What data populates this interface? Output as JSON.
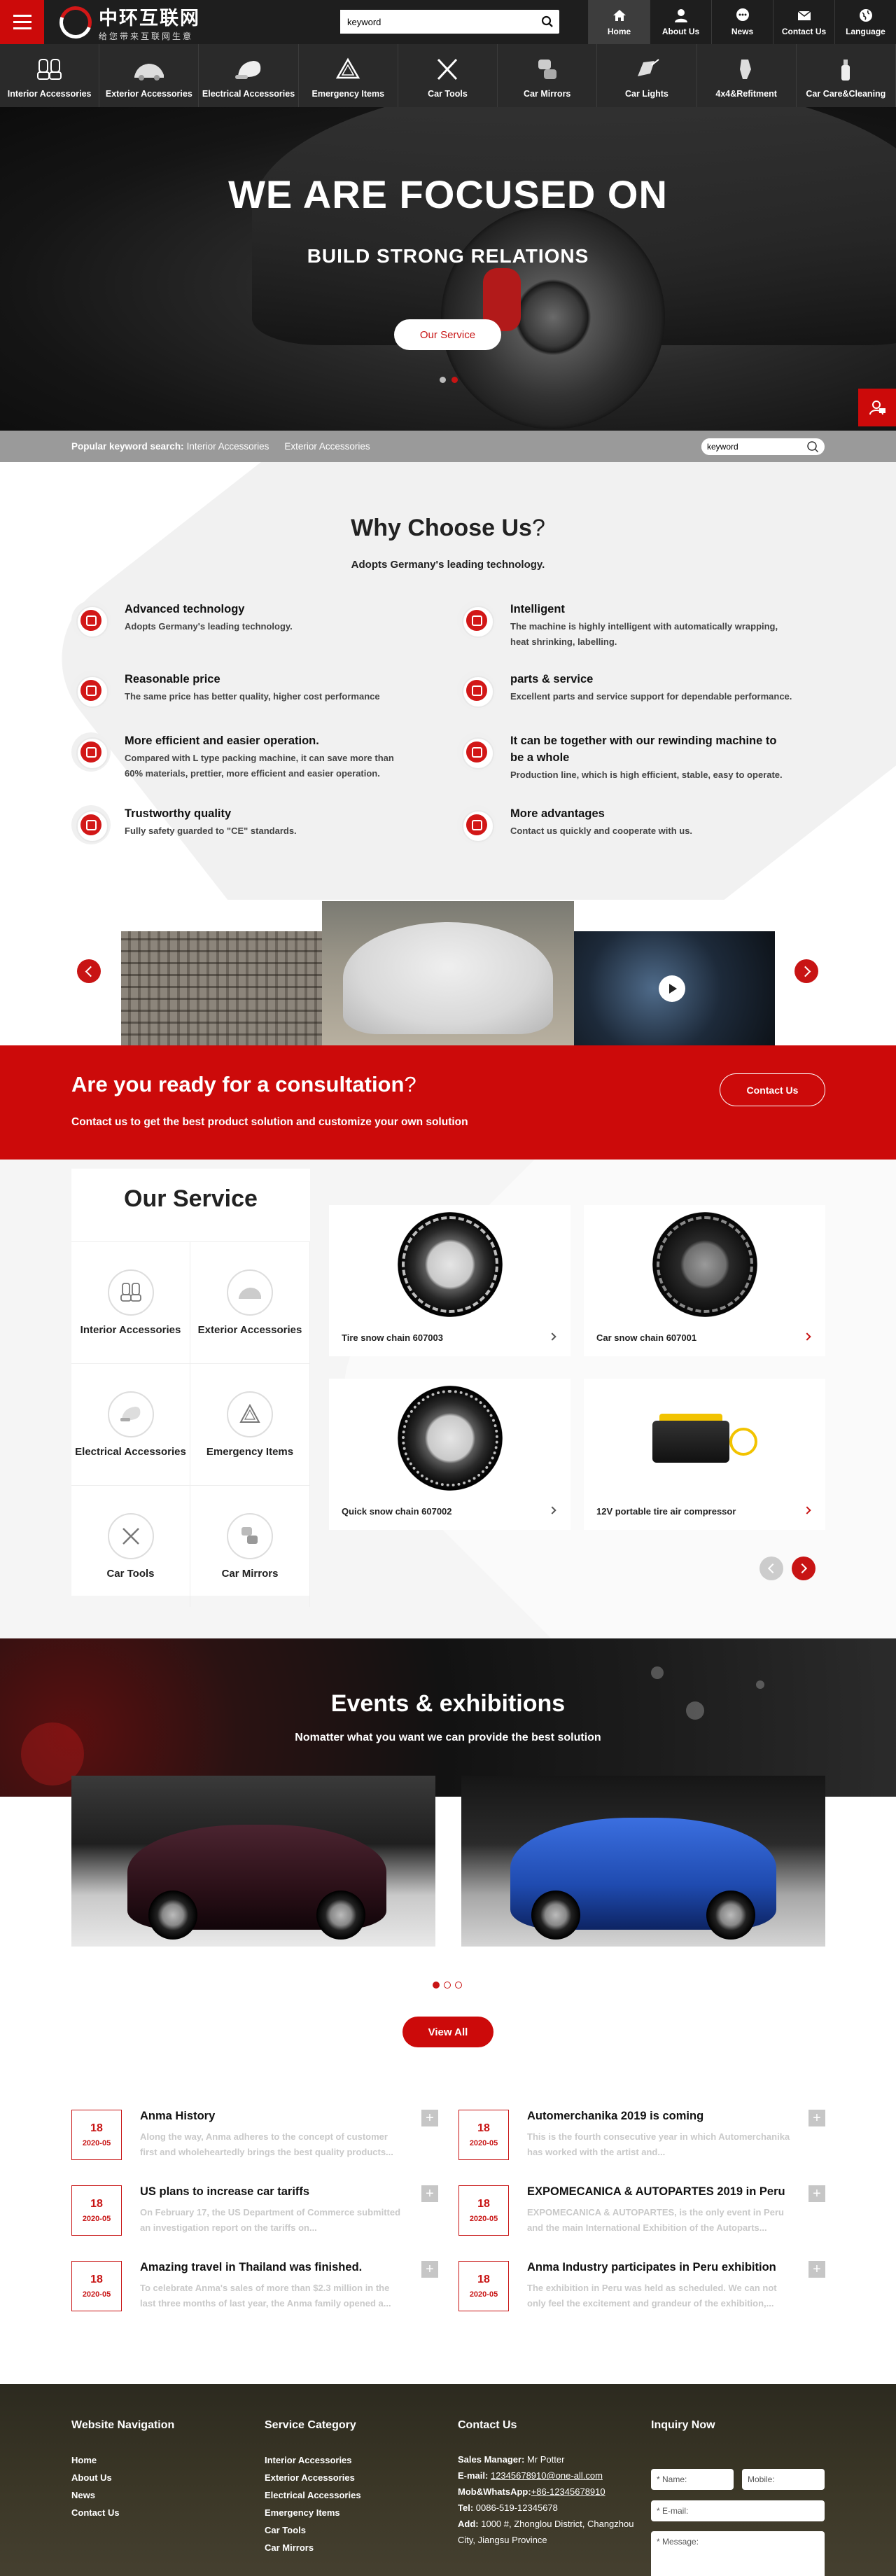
{
  "header": {
    "logo_title": "中环互联网",
    "logo_sub": "给您带来互联网生意",
    "search_placeholder": "keyword",
    "nav": [
      {
        "label": "Home",
        "icon": "home-icon"
      },
      {
        "label": "About Us",
        "icon": "user-icon"
      },
      {
        "label": "News",
        "icon": "chat-icon"
      },
      {
        "label": "Contact Us",
        "icon": "mail-icon"
      },
      {
        "label": "Language",
        "icon": "globe-icon"
      }
    ]
  },
  "categories": [
    {
      "label": "Interior Accessories",
      "icon": "car-seats-icon"
    },
    {
      "label": "Exterior Accessories",
      "icon": "car-cover-icon"
    },
    {
      "label": "Electrical Accessories",
      "icon": "electrical-icon"
    },
    {
      "label": "Emergency Items",
      "icon": "warning-triangle-icon"
    },
    {
      "label": "Car Tools",
      "icon": "tools-icon"
    },
    {
      "label": "Car Mirrors",
      "icon": "mirror-icon"
    },
    {
      "label": "Car Lights",
      "icon": "light-icon"
    },
    {
      "label": "4x4&Refitment",
      "icon": "refitment-icon"
    },
    {
      "label": "Car Care&Cleaning",
      "icon": "spray-icon"
    }
  ],
  "hero": {
    "title": "WE ARE FOCUSED ON",
    "subtitle": "BUILD STRONG RELATIONS",
    "button": "Our Service"
  },
  "keyword_bar": {
    "label": "Popular keyword search:",
    "links": [
      "Interior Accessories",
      "Exterior Accessories"
    ],
    "search_placeholder": "keyword"
  },
  "why": {
    "title_main": "Why Choose Us",
    "title_q": "?",
    "subtitle": "Adopts Germany's leading technology.",
    "features": [
      {
        "title": "Advanced technology",
        "desc": "Adopts Germany's leading technology."
      },
      {
        "title": "Intelligent",
        "desc": "The machine is highly intelligent with automatically wrapping, heat shrinking, labelling."
      },
      {
        "title": "Reasonable price",
        "desc": "The same price has better quality, higher cost performance"
      },
      {
        "title": "parts & service",
        "desc": "Excellent parts and service support for dependable performance."
      },
      {
        "title": "More efficient and easier operation.",
        "desc": "Compared with L type packing machine, it can save more than 60% materials, prettier, more efficient and easier operation."
      },
      {
        "title": "It can be together with our rewinding machine to be a whole",
        "desc": "Production line, which is high efficient, stable, easy to operate."
      },
      {
        "title": "Trustworthy quality",
        "desc": "Fully safety guarded to \"CE\" standards."
      },
      {
        "title": "More advantages",
        "desc": "Contact us quickly and cooperate with us."
      }
    ]
  },
  "consult": {
    "title_main": "Are you ready for a consultation",
    "title_q": "?",
    "desc": "Contact us to get the best product solution and customize your own solution",
    "button": "Contact Us"
  },
  "service": {
    "title": "Our Service",
    "categories": [
      {
        "label": "Interior Accessories",
        "icon": "car-seats-icon"
      },
      {
        "label": "Exterior Accessories",
        "icon": "car-cover-icon"
      },
      {
        "label": "Electrical Accessories",
        "icon": "electrical-icon"
      },
      {
        "label": "Emergency Items",
        "icon": "warning-triangle-icon"
      },
      {
        "label": "Car Tools",
        "icon": "tools-icon"
      },
      {
        "label": "Car Mirrors",
        "icon": "mirror-icon"
      }
    ],
    "products": [
      {
        "name": "Tire snow chain 607003"
      },
      {
        "name": "Car snow chain 607001"
      },
      {
        "name": "Quick snow chain 607002"
      },
      {
        "name": "12V portable tire air compressor"
      }
    ]
  },
  "events": {
    "title": "Events & exhibitions",
    "subtitle": "Nomatter what you want we can provide the best solution",
    "view_all": "View All",
    "news": [
      {
        "day": "18",
        "month": "2020-05",
        "title": "Anma History",
        "desc": "Along the way, Anma adheres to the concept of customer first and wholeheartedly brings the best quality products..."
      },
      {
        "day": "18",
        "month": "2020-05",
        "title": "Automerchanika 2019 is coming",
        "desc": "This is the fourth consecutive year in which Automerchanika has worked with the artist and..."
      },
      {
        "day": "18",
        "month": "2020-05",
        "title": "US plans to increase car tariffs",
        "desc": "On February 17, the US Department of Commerce submitted an investigation report on the tariffs on..."
      },
      {
        "day": "18",
        "month": "2020-05",
        "title": "EXPOMECANICA & AUTOPARTES 2019 in Peru",
        "desc": "EXPOMECANICA & AUTOPARTES, is the only event in Peru and the main International Exhibition of the Autoparts..."
      },
      {
        "day": "18",
        "month": "2020-05",
        "title": "Amazing travel in Thailand was finished.",
        "desc": "To celebrate Anma's sales of more than $2.3 million in the last three months of last year, the Anma family opened a..."
      },
      {
        "day": "18",
        "month": "2020-05",
        "title": "Anma Industry participates in Peru exhibition",
        "desc": "The exhibition in Peru was held as scheduled. We can not only feel the excitement and grandeur of the exhibition,..."
      }
    ]
  },
  "footer": {
    "nav_title": "Website Navigation",
    "nav_items": [
      "Home",
      "About Us",
      "News",
      "Contact Us"
    ],
    "cat_title": "Service Category",
    "cat_items": [
      "Interior Accessories",
      "Exterior Accessories",
      "Electrical Accessories",
      "Emergency Items",
      "Car Tools",
      "Car Mirrors"
    ],
    "contact_title": "Contact Us",
    "manager_label": "Sales Manager:",
    "manager": "Mr Potter",
    "email_label": "E-mail:",
    "email": "12345678910@one-all.com",
    "mob_label": "Mob&WhatsApp:",
    "mob": "+86-12345678910",
    "tel_label": "Tel:",
    "tel": "0086-519-12345678",
    "add_label": "Add:",
    "add": "1000 #, Zhonglou District, Changzhou City, Jiangsu Province",
    "inquiry_title": "Inquiry Now",
    "name_ph": "* Name:",
    "mobile_ph": "Mobile:",
    "email_ph": "* E-mail:",
    "message_ph": "* Message:"
  },
  "colors": {
    "brand_red": "#cc0a0a",
    "header_dark": "#1e1e1e"
  }
}
